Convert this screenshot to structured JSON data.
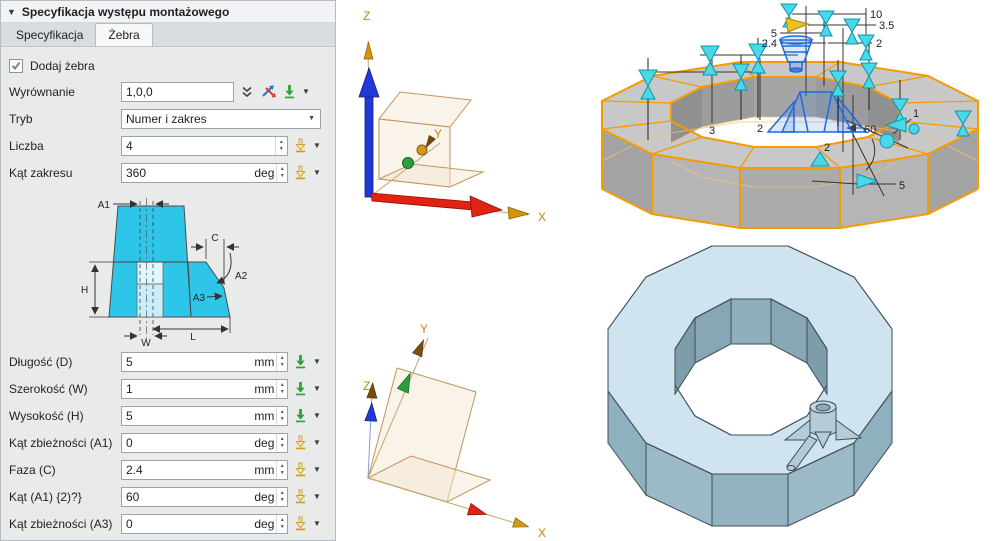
{
  "icons": {
    "collapse": "▼",
    "caret": "▼",
    "combo_caret": "▼",
    "spinner_up": "▲",
    "spinner_down": "▼"
  },
  "panel": {
    "title": "Specyfikacja występu montażowego",
    "tabs": [
      {
        "label": "Specyfikacja"
      },
      {
        "label": "Żebra"
      }
    ],
    "add_ribs_label": "Dodaj żebra",
    "alignment": {
      "label": "Wyrównanie",
      "value": "1,0,0"
    },
    "mode": {
      "label": "Tryb",
      "value": "Numer i zakres"
    },
    "count": {
      "label": "Liczba",
      "value": "4"
    },
    "range_angle": {
      "label": "Kąt zakresu",
      "value": "360",
      "unit": "deg"
    },
    "dims": [
      {
        "label": "Długość (D)",
        "value": "5",
        "unit": "mm"
      },
      {
        "label": "Szerokość (W)",
        "value": "1",
        "unit": "mm"
      },
      {
        "label": "Wysokość (H)",
        "value": "5",
        "unit": "mm"
      },
      {
        "label": "Kąt zbieżności (A1)",
        "value": "0",
        "unit": "deg"
      },
      {
        "label": "Faza (C)",
        "value": "2.4",
        "unit": "mm"
      },
      {
        "label": "Kąt (A1) {2)?}",
        "value": "60",
        "unit": "deg"
      },
      {
        "label": "Kąt zbieżności (A3)",
        "value": "0",
        "unit": "deg"
      }
    ],
    "diagram": {
      "a1": "A1",
      "c": "C",
      "a2": "A2",
      "a3": "A3",
      "h": "H",
      "l": "L",
      "w": "W"
    }
  },
  "viewport": {
    "triad_top": {
      "x": "X",
      "y": "Y",
      "z": "Z"
    },
    "triad_bottom": {
      "x": "X",
      "y": "Y",
      "z": "Z"
    },
    "dims": {
      "d10": "10",
      "d35": "3.5",
      "d5": "5",
      "d24": "2.4",
      "d2r": "2",
      "d3": "3",
      "d2a": "2",
      "d2b": "2",
      "d60": "60",
      "d5b": "5",
      "d1": "1"
    }
  },
  "colors": {
    "accent_orange": "#f59b00",
    "handle_cyan": "#48d8e8",
    "preview_blue": "#1c6be0",
    "diagram_cyan": "#2ec6e8",
    "green_icon": "#2f9e3e",
    "gold_icon": "#cf9a1d",
    "axis_red": "#e02313",
    "axis_blue": "#2238d8",
    "axis_green": "#2d9e3a",
    "axis_label": "#c8820a"
  }
}
